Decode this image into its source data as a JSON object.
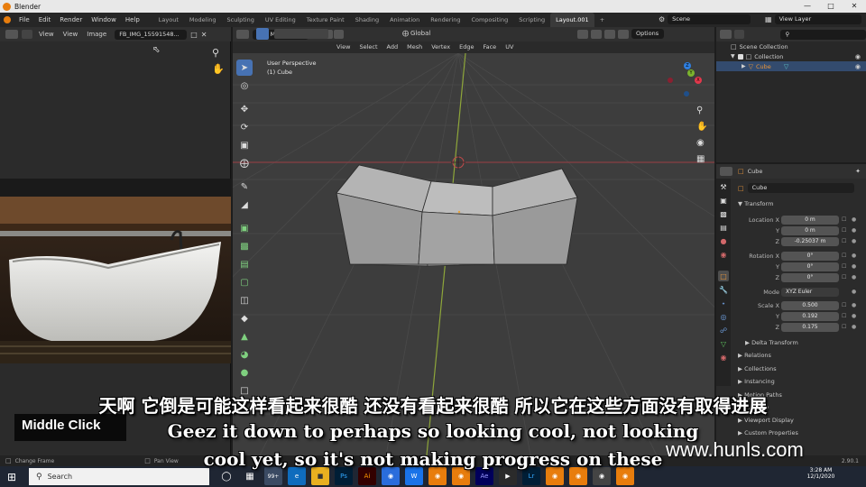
{
  "window": {
    "title": "Blender"
  },
  "menu": {
    "items": [
      "File",
      "Edit",
      "Render",
      "Window",
      "Help"
    ],
    "tabs": [
      "Layout",
      "Modeling",
      "Sculpting",
      "UV Editing",
      "Texture Paint",
      "Shading",
      "Animation",
      "Rendering",
      "Compositing",
      "Scripting",
      "Layout.001"
    ],
    "active_tab": "Layout.001",
    "scene": "Scene",
    "view_layer": "View Layer"
  },
  "image_editor": {
    "menus": [
      "View",
      "View",
      "Image"
    ],
    "image_name": "FB_IMG_15591548..."
  },
  "viewport": {
    "mode": "Edit Mode",
    "menus": [
      "View",
      "Select",
      "Add",
      "Mesh",
      "Vertex",
      "Edge",
      "Face",
      "UV"
    ],
    "transform_orientation": "Global",
    "options_label": "Options",
    "overlay_title": "User Perspective",
    "overlay_object": "(1) Cube",
    "axes": {
      "x": "X",
      "y": "Y",
      "z": "Z"
    }
  },
  "outliner": {
    "root": "Scene Collection",
    "collection": "Collection",
    "object": "Cube"
  },
  "properties": {
    "object_name": "Cube",
    "data_name": "Cube",
    "transform_header": "Transform",
    "location_label": "Location X",
    "y_label": "Y",
    "z_label": "Z",
    "location": [
      "0 m",
      "0 m",
      "-0.25037 m"
    ],
    "rotation_label": "Rotation X",
    "rotation": [
      "0°",
      "0°",
      "0°"
    ],
    "mode_label": "Mode",
    "rotation_mode": "XYZ Euler",
    "scale_label": "Scale X",
    "scale": [
      "0.500",
      "0.192",
      "0.175"
    ],
    "delta_transform": "Delta Transform",
    "sections": [
      "Relations",
      "Collections",
      "Instancing",
      "Motion Paths",
      "Visibility",
      "Viewport Display",
      "Custom Properties"
    ]
  },
  "statusbar": {
    "left": "Change Frame",
    "middle": "Pan View",
    "version": "2.90.1"
  },
  "taskbar": {
    "search_placeholder": "Search",
    "time": "3:28 AM",
    "date": "12/1/2020",
    "badge": "99+"
  },
  "overlays": {
    "key_hint": "Middle Click",
    "subtitle_cn": "天啊 它倒是可能这样看起来很酷 还没有看起来很酷 所以它在这些方面没有取得进展",
    "subtitle_en_1": "Geez it down to perhaps so looking cool, not looking",
    "subtitle_en_2": "cool yet, so it's not making progress on these",
    "watermark": "www.hunls.com"
  },
  "colors": {
    "accent": "#4772b3",
    "orange": "#e87d0d",
    "viewport_bg": "#3d3d3d"
  }
}
